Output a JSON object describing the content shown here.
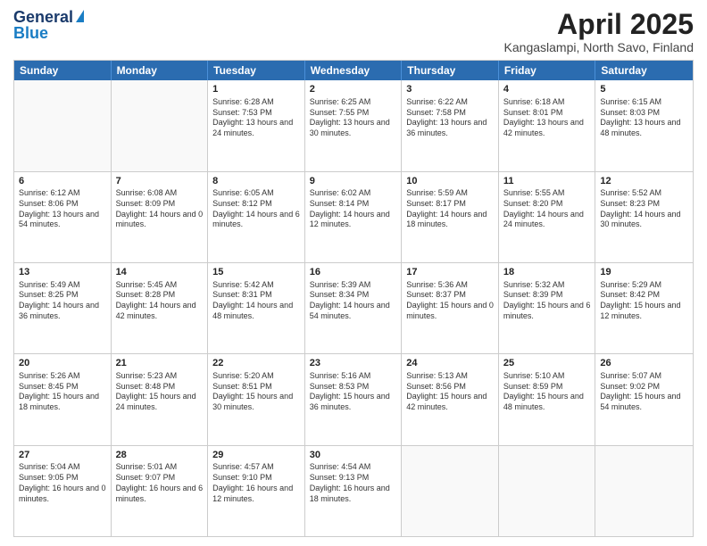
{
  "header": {
    "logo_line1": "General",
    "logo_line2": "Blue",
    "title": "April 2025",
    "subtitle": "Kangaslampi, North Savo, Finland"
  },
  "days_of_week": [
    "Sunday",
    "Monday",
    "Tuesday",
    "Wednesday",
    "Thursday",
    "Friday",
    "Saturday"
  ],
  "weeks": [
    [
      {
        "day": "",
        "info": ""
      },
      {
        "day": "",
        "info": ""
      },
      {
        "day": "1",
        "info": "Sunrise: 6:28 AM\nSunset: 7:53 PM\nDaylight: 13 hours and 24 minutes."
      },
      {
        "day": "2",
        "info": "Sunrise: 6:25 AM\nSunset: 7:55 PM\nDaylight: 13 hours and 30 minutes."
      },
      {
        "day": "3",
        "info": "Sunrise: 6:22 AM\nSunset: 7:58 PM\nDaylight: 13 hours and 36 minutes."
      },
      {
        "day": "4",
        "info": "Sunrise: 6:18 AM\nSunset: 8:01 PM\nDaylight: 13 hours and 42 minutes."
      },
      {
        "day": "5",
        "info": "Sunrise: 6:15 AM\nSunset: 8:03 PM\nDaylight: 13 hours and 48 minutes."
      }
    ],
    [
      {
        "day": "6",
        "info": "Sunrise: 6:12 AM\nSunset: 8:06 PM\nDaylight: 13 hours and 54 minutes."
      },
      {
        "day": "7",
        "info": "Sunrise: 6:08 AM\nSunset: 8:09 PM\nDaylight: 14 hours and 0 minutes."
      },
      {
        "day": "8",
        "info": "Sunrise: 6:05 AM\nSunset: 8:12 PM\nDaylight: 14 hours and 6 minutes."
      },
      {
        "day": "9",
        "info": "Sunrise: 6:02 AM\nSunset: 8:14 PM\nDaylight: 14 hours and 12 minutes."
      },
      {
        "day": "10",
        "info": "Sunrise: 5:59 AM\nSunset: 8:17 PM\nDaylight: 14 hours and 18 minutes."
      },
      {
        "day": "11",
        "info": "Sunrise: 5:55 AM\nSunset: 8:20 PM\nDaylight: 14 hours and 24 minutes."
      },
      {
        "day": "12",
        "info": "Sunrise: 5:52 AM\nSunset: 8:23 PM\nDaylight: 14 hours and 30 minutes."
      }
    ],
    [
      {
        "day": "13",
        "info": "Sunrise: 5:49 AM\nSunset: 8:25 PM\nDaylight: 14 hours and 36 minutes."
      },
      {
        "day": "14",
        "info": "Sunrise: 5:45 AM\nSunset: 8:28 PM\nDaylight: 14 hours and 42 minutes."
      },
      {
        "day": "15",
        "info": "Sunrise: 5:42 AM\nSunset: 8:31 PM\nDaylight: 14 hours and 48 minutes."
      },
      {
        "day": "16",
        "info": "Sunrise: 5:39 AM\nSunset: 8:34 PM\nDaylight: 14 hours and 54 minutes."
      },
      {
        "day": "17",
        "info": "Sunrise: 5:36 AM\nSunset: 8:37 PM\nDaylight: 15 hours and 0 minutes."
      },
      {
        "day": "18",
        "info": "Sunrise: 5:32 AM\nSunset: 8:39 PM\nDaylight: 15 hours and 6 minutes."
      },
      {
        "day": "19",
        "info": "Sunrise: 5:29 AM\nSunset: 8:42 PM\nDaylight: 15 hours and 12 minutes."
      }
    ],
    [
      {
        "day": "20",
        "info": "Sunrise: 5:26 AM\nSunset: 8:45 PM\nDaylight: 15 hours and 18 minutes."
      },
      {
        "day": "21",
        "info": "Sunrise: 5:23 AM\nSunset: 8:48 PM\nDaylight: 15 hours and 24 minutes."
      },
      {
        "day": "22",
        "info": "Sunrise: 5:20 AM\nSunset: 8:51 PM\nDaylight: 15 hours and 30 minutes."
      },
      {
        "day": "23",
        "info": "Sunrise: 5:16 AM\nSunset: 8:53 PM\nDaylight: 15 hours and 36 minutes."
      },
      {
        "day": "24",
        "info": "Sunrise: 5:13 AM\nSunset: 8:56 PM\nDaylight: 15 hours and 42 minutes."
      },
      {
        "day": "25",
        "info": "Sunrise: 5:10 AM\nSunset: 8:59 PM\nDaylight: 15 hours and 48 minutes."
      },
      {
        "day": "26",
        "info": "Sunrise: 5:07 AM\nSunset: 9:02 PM\nDaylight: 15 hours and 54 minutes."
      }
    ],
    [
      {
        "day": "27",
        "info": "Sunrise: 5:04 AM\nSunset: 9:05 PM\nDaylight: 16 hours and 0 minutes."
      },
      {
        "day": "28",
        "info": "Sunrise: 5:01 AM\nSunset: 9:07 PM\nDaylight: 16 hours and 6 minutes."
      },
      {
        "day": "29",
        "info": "Sunrise: 4:57 AM\nSunset: 9:10 PM\nDaylight: 16 hours and 12 minutes."
      },
      {
        "day": "30",
        "info": "Sunrise: 4:54 AM\nSunset: 9:13 PM\nDaylight: 16 hours and 18 minutes."
      },
      {
        "day": "",
        "info": ""
      },
      {
        "day": "",
        "info": ""
      },
      {
        "day": "",
        "info": ""
      }
    ]
  ]
}
